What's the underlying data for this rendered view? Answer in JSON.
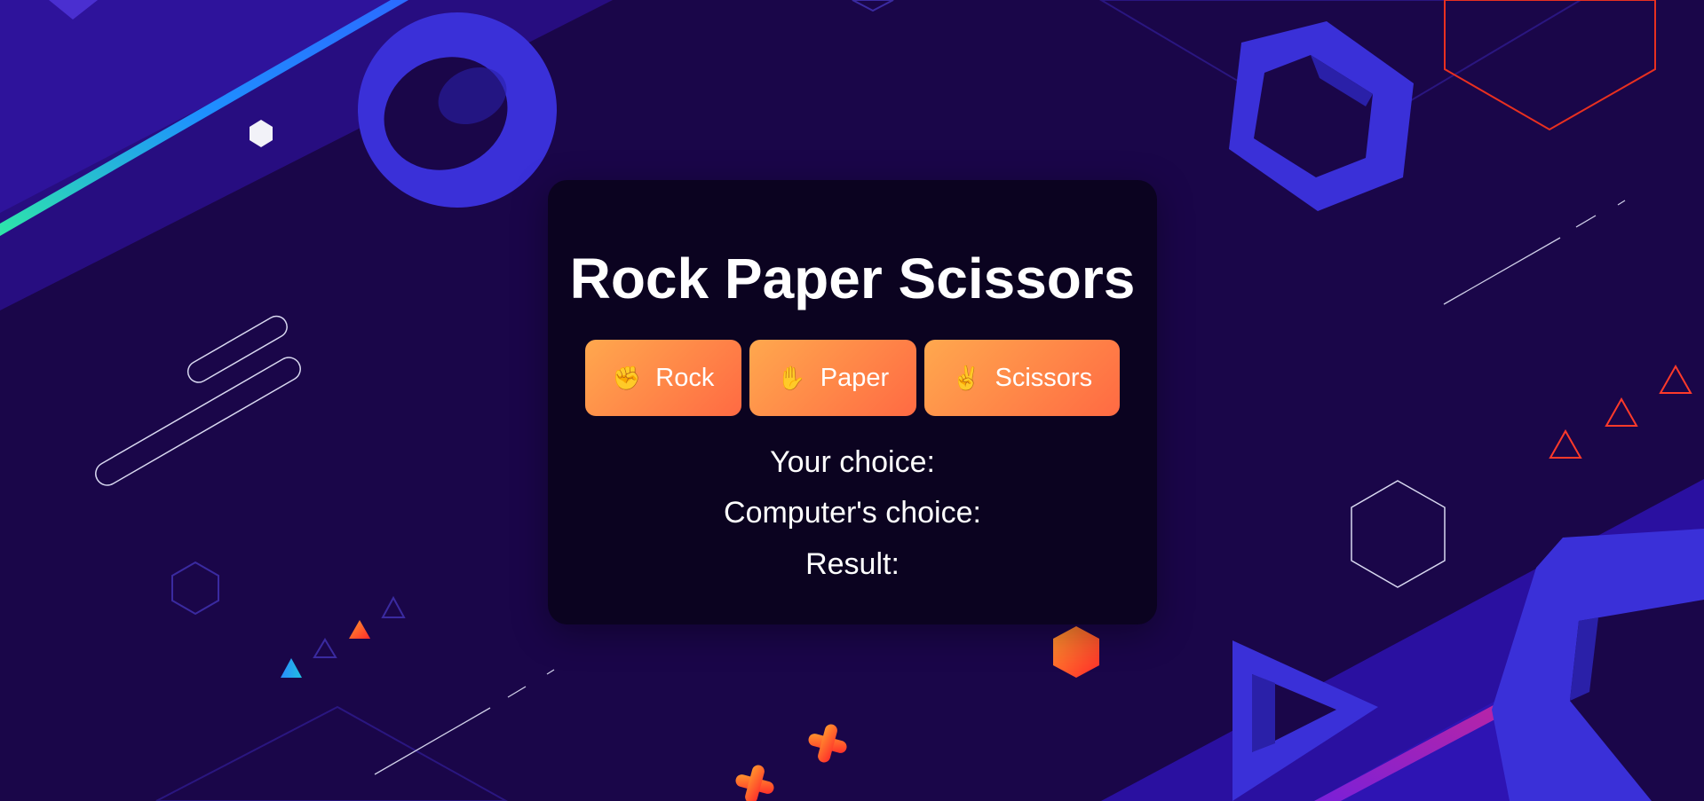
{
  "game": {
    "title": "Rock Paper Scissors",
    "buttons": [
      {
        "label": "Rock",
        "icon": "✊"
      },
      {
        "label": "Paper",
        "icon": "✋"
      },
      {
        "label": "Scissors",
        "icon": "✌"
      }
    ],
    "your_choice_label": "Your choice:",
    "computer_choice_label": "Computer's choice:",
    "result_label": "Result:"
  },
  "colors": {
    "background": "#1a0649",
    "card": "#0b0320",
    "button_start": "#ffa84e",
    "button_end": "#ff6a43"
  }
}
